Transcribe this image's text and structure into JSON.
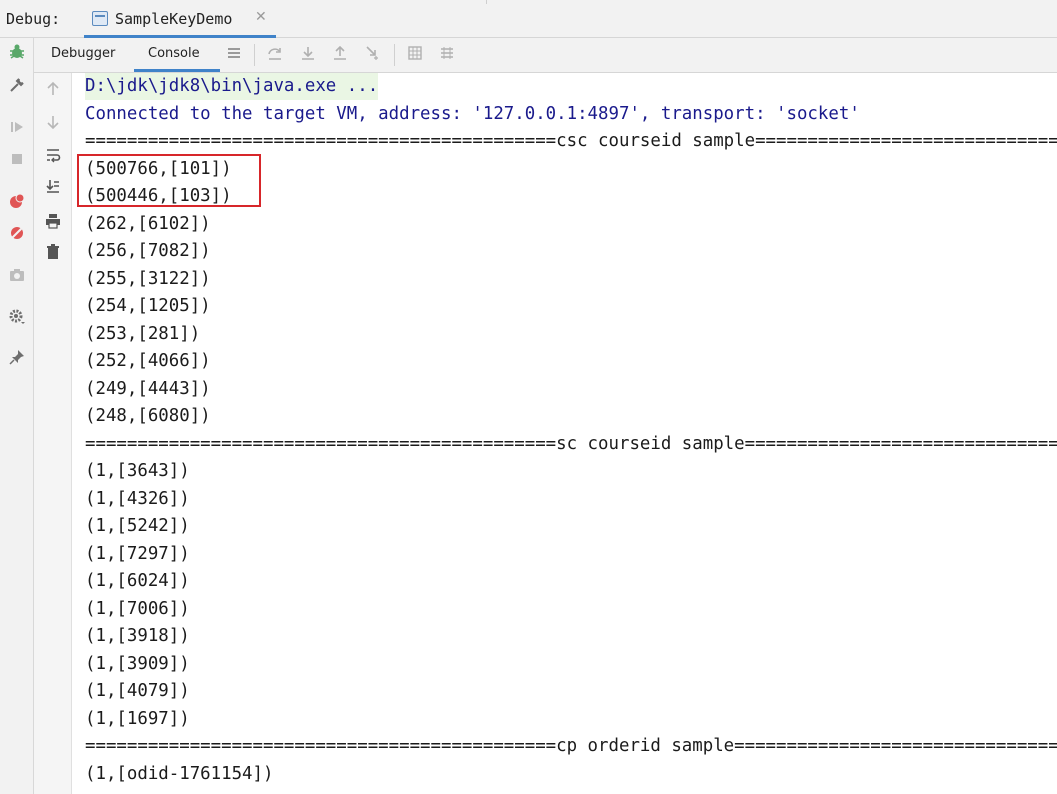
{
  "debug_bar": {
    "label": "Debug:",
    "session": {
      "name": "SampleKeyDemo",
      "close": "✕"
    }
  },
  "tabs": {
    "debugger_label": "Debugger",
    "console_label": "Console"
  },
  "console": {
    "lines": [
      "D:\\jdk\\jdk8\\bin\\java.exe ...",
      "Connected to the target VM, address: '127.0.0.1:4897', transport: 'socket'",
      "=============================================csc courseid sample=============================================",
      "(500766,[101])",
      "(500446,[103])",
      "(262,[6102])",
      "(256,[7082])",
      "(255,[3122])",
      "(254,[1205])",
      "(253,[281])",
      "(252,[4066])",
      "(249,[4443])",
      "(248,[6080])",
      "=============================================sc courseid sample=============================================",
      "(1,[3643])",
      "(1,[4326])",
      "(1,[5242])",
      "(1,[7297])",
      "(1,[6024])",
      "(1,[7006])",
      "(1,[3918])",
      "(1,[3909])",
      "(1,[4079])",
      "(1,[1697])",
      "=============================================cp orderid sample=============================================",
      "(1,[odid-1761154])"
    ]
  },
  "colors": {
    "accent": "#4083c9",
    "highlight_box": "#d7262a",
    "command_text": "#1a1a8c",
    "command_bg": "#eaf6e4"
  }
}
